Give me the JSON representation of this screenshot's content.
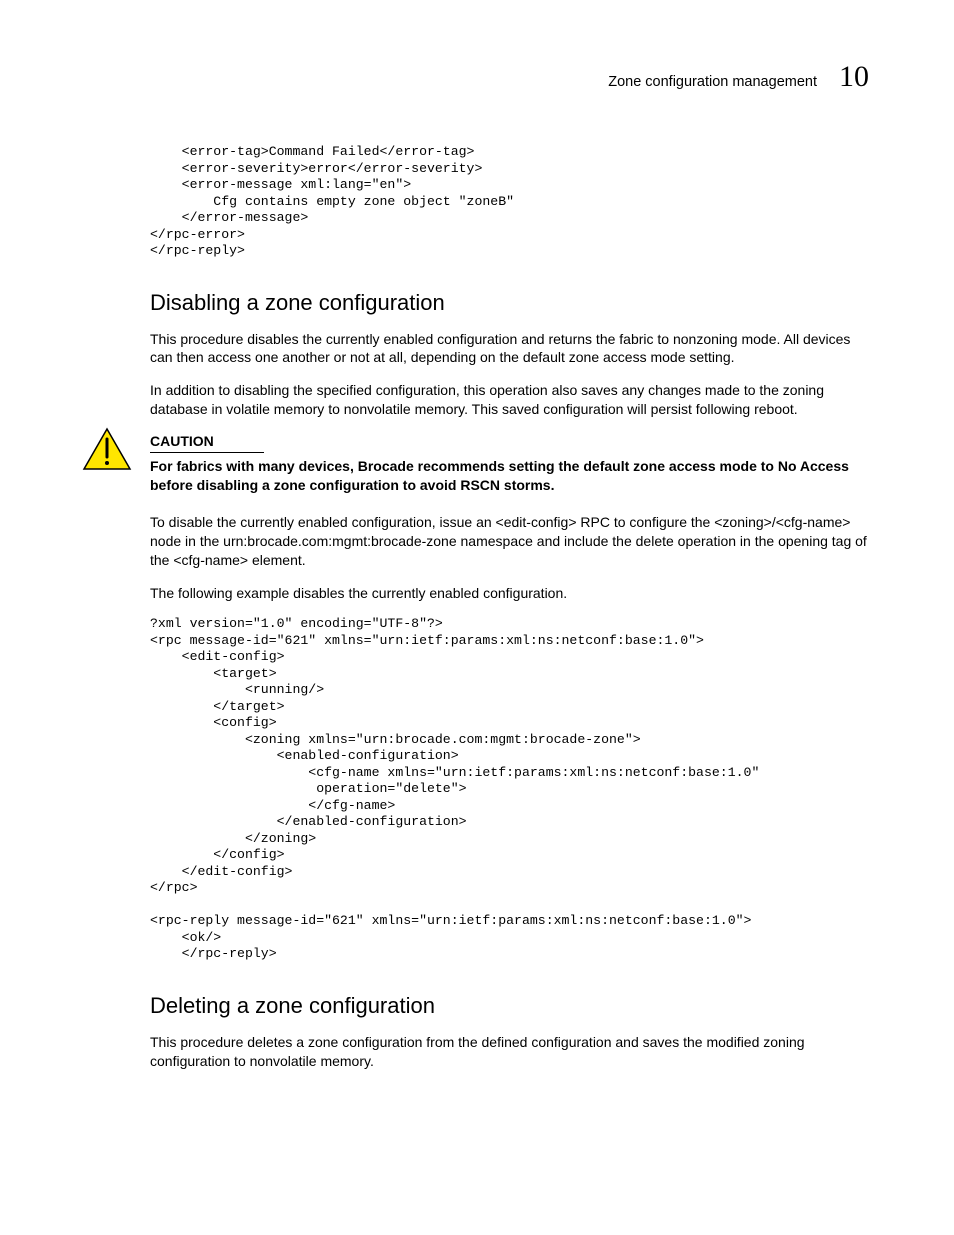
{
  "header": {
    "title": "Zone configuration management",
    "chapter": "10"
  },
  "code1": "    <error-tag>Command Failed</error-tag>\n    <error-severity>error</error-severity>\n    <error-message xml:lang=\"en\">\n        Cfg contains empty zone object \"zoneB\"\n    </error-message>\n</rpc-error>\n</rpc-reply>",
  "section1": {
    "heading": "Disabling a zone configuration",
    "p1": "This procedure disables the currently enabled configuration and returns the fabric to nonzoning mode. All devices can then access one another or not at all, depending on the default zone access mode setting.",
    "p2": "In addition to disabling the specified configuration, this operation also saves any changes made to the zoning database in volatile memory to nonvolatile memory. This saved configuration will persist following reboot.",
    "caution_label": "CAUTION",
    "caution_text": "For fabrics with many devices, Brocade recommends setting the default zone access mode to No Access before disabling a zone configuration to avoid RSCN storms.",
    "p3": "To disable the currently enabled configuration, issue an <edit-config> RPC to configure the <zoning>/<cfg-name> node in the urn:brocade.com:mgmt:brocade-zone namespace and include the delete operation in the opening tag of the <cfg-name> element.",
    "p4": "The following example disables the currently enabled configuration."
  },
  "code2": "?xml version=\"1.0\" encoding=\"UTF-8\"?>\n<rpc message-id=\"621\" xmlns=\"urn:ietf:params:xml:ns:netconf:base:1.0\">\n    <edit-config>\n        <target>\n            <running/>\n        </target>\n        <config>\n            <zoning xmlns=\"urn:brocade.com:mgmt:brocade-zone\">\n                <enabled-configuration>\n                    <cfg-name xmlns=\"urn:ietf:params:xml:ns:netconf:base:1.0\"\n                     operation=\"delete\">\n                    </cfg-name>\n                </enabled-configuration>\n            </zoning>\n        </config>\n    </edit-config>\n</rpc>\n\n<rpc-reply message-id=\"621\" xmlns=\"urn:ietf:params:xml:ns:netconf:base:1.0\">\n    <ok/>\n    </rpc-reply>",
  "section2": {
    "heading": "Deleting a zone configuration",
    "p1": "This procedure deletes a zone configuration from the defined configuration and saves the modified zoning configuration to nonvolatile memory."
  }
}
